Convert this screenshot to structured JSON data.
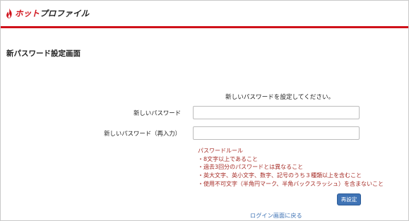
{
  "brand": {
    "logo_hot": "ホット",
    "logo_rest": "プロファイル",
    "accent_color": "#d0121b"
  },
  "page": {
    "title": "新パスワード設定画面"
  },
  "form": {
    "instruction": "新しいパスワードを設定してください。",
    "new_password_label": "新しいパスワード",
    "new_password_value": "",
    "confirm_password_label": "新しいパスワード（再入力）",
    "confirm_password_value": "",
    "rules_title": "パスワードルール",
    "rules": [
      "・8文字以上であること",
      "・過去3回分のパスワードとは異なること",
      "・英大文字、英小文字、数字、記号のうち３種類以上を含むこと",
      "・使用不可文字（半角円マーク、半角バックスラッシュ）を含まないこと"
    ],
    "rules_color": "#a52a24",
    "submit_label": "再設定",
    "button_color": "#3f73b5",
    "back_link": "ログイン画面に戻る"
  },
  "icons": {
    "logo_icon": "flame-icon"
  }
}
